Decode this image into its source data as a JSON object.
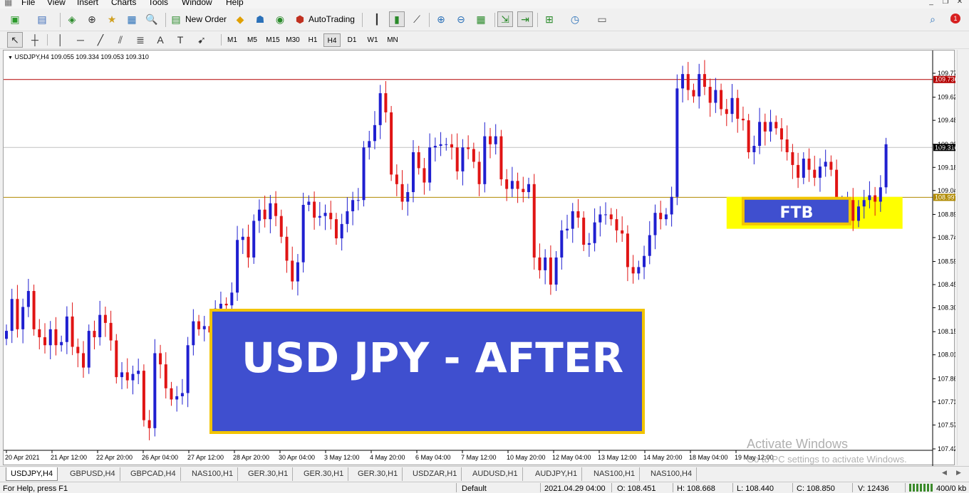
{
  "menu": [
    "File",
    "View",
    "Insert",
    "Charts",
    "Tools",
    "Window",
    "Help"
  ],
  "toolbar": {
    "new_order_label": "New Order",
    "autotrading_label": "AutoTrading",
    "notification_count": "1"
  },
  "timeframes": [
    "M1",
    "M5",
    "M15",
    "M30",
    "H1",
    "H4",
    "D1",
    "W1",
    "MN"
  ],
  "active_timeframe": "H4",
  "chart": {
    "symbol_header": "USDJPY,H4  109.055 109.334 109.053 109.310",
    "overlay_title": "USD JPY - AFTER",
    "ftb_label": "FTB",
    "colors": {
      "bull": "#1f1fd0",
      "bear": "#e01414",
      "overlay_fill": "#3f4fcf",
      "overlay_border": "#f2c400",
      "highlight_zone": "#ffff00",
      "resistance": "#b40000",
      "support": "#b08a00"
    }
  },
  "chart_data": {
    "type": "candlestick",
    "symbol": "USDJPY",
    "timeframe": "H4",
    "ohlc_header": {
      "open": 109.055,
      "high": 109.334,
      "low": 109.053,
      "close": 109.31
    },
    "price_ticks": [
      "109.775",
      "109.625",
      "109.480",
      "109.330",
      "109.185",
      "109.040",
      "108.890",
      "108.745",
      "108.595",
      "108.450",
      "108.305",
      "108.155",
      "108.010",
      "107.860",
      "107.715",
      "107.570",
      "107.420"
    ],
    "ylim": [
      107.42,
      109.775
    ],
    "date_ticks": [
      "20 Apr 2021",
      "21 Apr 12:00",
      "22 Apr 20:00",
      "26 Apr 04:00",
      "27 Apr 12:00",
      "28 Apr 20:00",
      "30 Apr 04:00",
      "3 May 12:00",
      "4 May 20:00",
      "6 May 04:00",
      "7 May 12:00",
      "10 May 20:00",
      "12 May 04:00",
      "13 May 12:00",
      "14 May 20:00",
      "18 May 04:00",
      "19 May 12:00"
    ],
    "horizontal_lines": [
      {
        "label": "109.736",
        "value": 109.736,
        "color": "#b40000"
      },
      {
        "label": "108.997",
        "value": 108.997,
        "color": "#b08a00"
      }
    ],
    "current_price": {
      "label": "109.310",
      "value": 109.31
    },
    "closes": [
      108.16,
      108.36,
      108.17,
      108.31,
      108.41,
      108.17,
      108.12,
      108.07,
      108.17,
      108.07,
      108.09,
      108.25,
      108.06,
      108.02,
      107.93,
      108.16,
      108.12,
      108.26,
      108.21,
      108.1,
      107.87,
      107.9,
      107.85,
      107.89,
      107.91,
      107.6,
      107.55,
      108.02,
      107.95,
      107.8,
      107.73,
      107.75,
      107.77,
      108.07,
      108.22,
      108.17,
      108.19,
      108.15,
      108.3,
      108.33,
      108.32,
      108.4,
      108.73,
      108.75,
      108.62,
      108.85,
      108.92,
      108.86,
      108.96,
      108.88,
      108.75,
      108.6,
      108.47,
      108.59,
      108.95,
      108.97,
      108.87,
      108.88,
      108.9,
      108.86,
      108.74,
      108.83,
      108.91,
      108.98,
      108.98,
      109.31,
      109.35,
      109.45,
      109.65,
      109.53,
      109.14,
      109.08,
      108.97,
      109.03,
      109.28,
      109.18,
      109.09,
      109.31,
      109.32,
      109.33,
      109.33,
      109.31,
      109.16,
      109.31,
      109.3,
      109.22,
      109.08,
      109.38,
      109.33,
      109.38,
      109.11,
      109.05,
      109.1,
      109.05,
      109.03,
      109.08,
      108.62,
      108.54,
      108.62,
      108.45,
      108.62,
      108.79,
      108.8,
      108.91,
      108.87,
      108.7,
      108.71,
      108.84,
      108.89,
      108.89,
      108.86,
      108.79,
      108.77,
      108.56,
      108.52,
      108.56,
      108.63,
      108.76,
      108.9,
      108.86,
      108.89,
      109.0,
      109.68,
      109.77,
      109.67,
      109.63,
      109.77,
      109.69,
      109.59,
      109.67,
      109.55,
      109.52,
      109.62,
      109.49,
      109.48,
      109.28,
      109.32,
      109.47,
      109.41,
      109.47,
      109.43,
      109.36,
      109.28,
      109.2,
      109.12,
      109.24,
      109.17,
      109.12,
      109.19,
      109.22,
      109.17,
      108.9,
      108.92,
      108.98,
      108.85,
      108.94,
      108.98,
      109.01,
      108.97,
      109.06,
      109.33
    ],
    "annotations": [
      "USD JPY - AFTER",
      "FTB"
    ]
  },
  "tabs": [
    "USDJPY,H4",
    "GBPUSD,H4",
    "GBPCAD,H4",
    "NAS100,H1",
    "GER.30,H1",
    "GER.30,H1",
    "GER.30,H1",
    "USDZAR,H1",
    "AUDUSD,H1",
    "AUDJPY,H1",
    "NAS100,H1",
    "NAS100,H4"
  ],
  "active_tab": "USDJPY,H4",
  "statusbar": {
    "help": "For Help, press F1",
    "profile": "Default",
    "datetime": "2021.04.29 04:00",
    "open": "O: 108.451",
    "high": "H: 108.668",
    "low": "L: 108.440",
    "close": "C: 108.850",
    "volume": "V: 12436",
    "traffic": "400/0 kb"
  },
  "watermark": {
    "line1": "Activate Windows",
    "line2": "Go to PC settings to activate Windows."
  }
}
